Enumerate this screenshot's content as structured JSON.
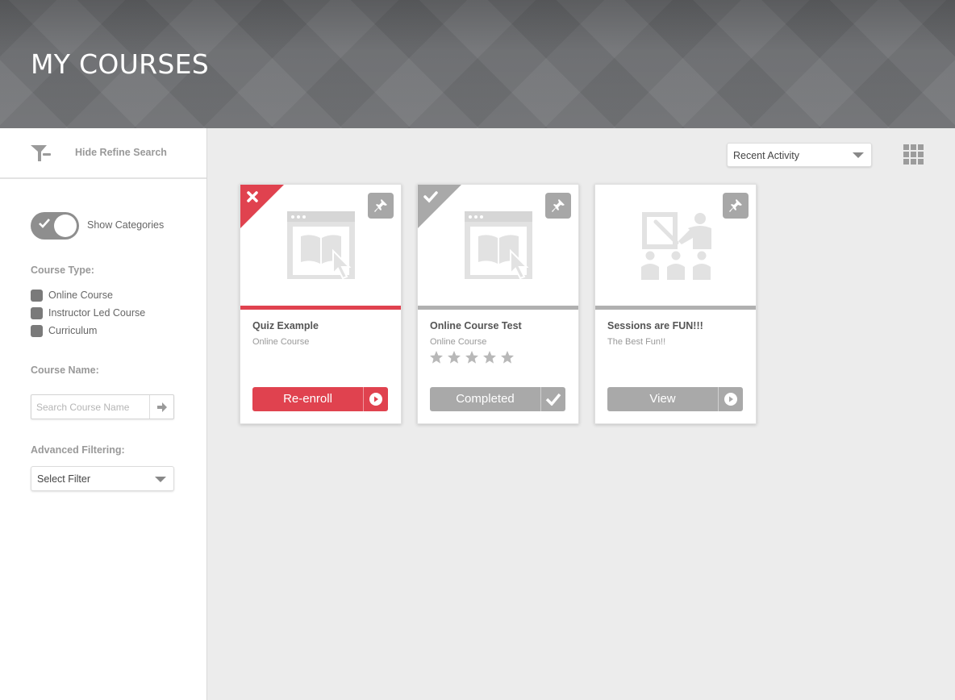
{
  "header": {
    "title": "MY COURSES"
  },
  "sidebar": {
    "refine_label": "Hide Refine Search",
    "toggle_label": "Show Categories",
    "course_type": {
      "heading": "Course Type:",
      "options": [
        "Online Course",
        "Instructor Led Course",
        "Curriculum"
      ]
    },
    "course_name": {
      "heading": "Course Name:",
      "placeholder": "Search Course Name"
    },
    "advanced": {
      "heading": "Advanced Filtering:",
      "select_value": "Select Filter"
    }
  },
  "main": {
    "sort_value": "Recent Activity",
    "cards": [
      {
        "title": "Quiz Example",
        "subtitle": "Online Course",
        "button": "Re-enroll",
        "status": "failed",
        "icon": "online-course-icon"
      },
      {
        "title": "Online Course Test",
        "subtitle": "Online Course",
        "button": "Completed",
        "status": "completed",
        "rating_stars": 5,
        "icon": "online-course-icon"
      },
      {
        "title": "Sessions are FUN!!!",
        "subtitle": "The Best Fun!!",
        "button": "View",
        "status": "none",
        "icon": "instructor-led-icon"
      }
    ]
  },
  "colors": {
    "accent_red": "#e0424f",
    "neutral_gray": "#a9a9a9",
    "header_bg": "#6e7073"
  }
}
